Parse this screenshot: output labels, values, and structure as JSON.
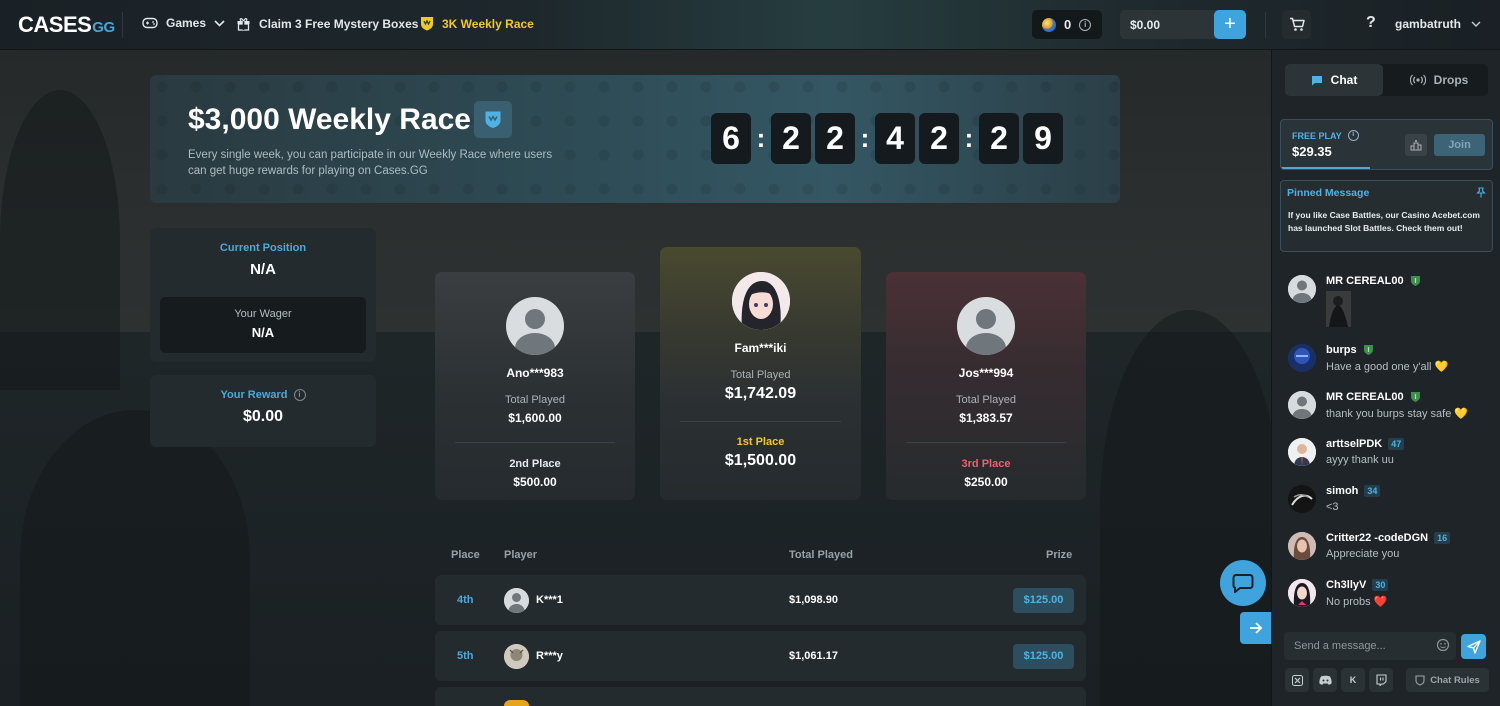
{
  "header": {
    "logo_main": "CASES",
    "logo_suffix": "GG",
    "nav": {
      "games": "Games",
      "mystery": "Claim 3 Free Mystery Boxes",
      "race": "3K Weekly Race"
    },
    "coins": "0",
    "wallet_balance": "$0.00",
    "plus": "+",
    "help": "?",
    "username": "gambatruth"
  },
  "hero": {
    "title": "$3,000 Weekly Race",
    "description": "Every single week, you can participate in our Weekly Race where users can get huge rewards for playing on Cases.GG",
    "timer": [
      "6",
      "2",
      "2",
      "4",
      "2",
      "2",
      "9"
    ],
    "separator": ":"
  },
  "stats": {
    "current_position_label": "Current Position",
    "current_position": "N/A",
    "wager_label": "Your Wager",
    "wager": "N/A",
    "reward_label": "Your Reward",
    "reward": "$0.00"
  },
  "podium": {
    "first": {
      "name": "Fam***iki",
      "played_label": "Total Played",
      "played": "$1,742.09",
      "place": "1st Place",
      "prize": "$1,500.00"
    },
    "second": {
      "name": "Ano***983",
      "played_label": "Total Played",
      "played": "$1,600.00",
      "place": "2nd Place",
      "prize": "$500.00"
    },
    "third": {
      "name": "Jos***994",
      "played_label": "Total Played",
      "played": "$1,383.57",
      "place": "3rd Place",
      "prize": "$250.00"
    }
  },
  "table": {
    "headers": {
      "place": "Place",
      "player": "Player",
      "total": "Total Played",
      "prize": "Prize"
    },
    "rows": [
      {
        "place": "4th",
        "player": "K***1",
        "total": "$1,098.90",
        "prize": "$125.00"
      },
      {
        "place": "5th",
        "player": "R***y",
        "total": "$1,061.17",
        "prize": "$125.00"
      }
    ]
  },
  "sidebar": {
    "tabs": {
      "chat": "Chat",
      "drops": "Drops"
    },
    "free_play": {
      "label": "FREE PLAY",
      "value": "$29.35",
      "join": "Join",
      "progress": 0.42
    },
    "pinned": {
      "title": "Pinned Message",
      "body": "If you like Case Battles, our Casino Acebet.com has launched Slot Battles. Check them out!"
    },
    "messages": [
      {
        "user": "MR CEREAL00",
        "text": "",
        "badge": ""
      },
      {
        "user": "burps",
        "text": "Have a good one y'all 💛",
        "badge": ""
      },
      {
        "user": "MR CEREAL00",
        "text": "thank you burps stay safe 💛",
        "badge": ""
      },
      {
        "user": "arttselPDK",
        "text": "ayyy thank uu",
        "badge": "47"
      },
      {
        "user": "simoh",
        "text": "<3",
        "badge": "34"
      },
      {
        "user": "Critter22 -codeDGN",
        "text": "Appreciate you",
        "badge": "16"
      },
      {
        "user": "Ch3llyV",
        "text": "No probs ❤️",
        "badge": "30"
      }
    ],
    "input_placeholder": "Send a message...",
    "kick": "K",
    "chat_rules": "Chat Rules"
  },
  "colors": {
    "accent": "#3fa4dd",
    "race_gold": "#f0c929",
    "first": "#f0c929",
    "second": "#e8ecef",
    "third": "#ef5f6f"
  }
}
